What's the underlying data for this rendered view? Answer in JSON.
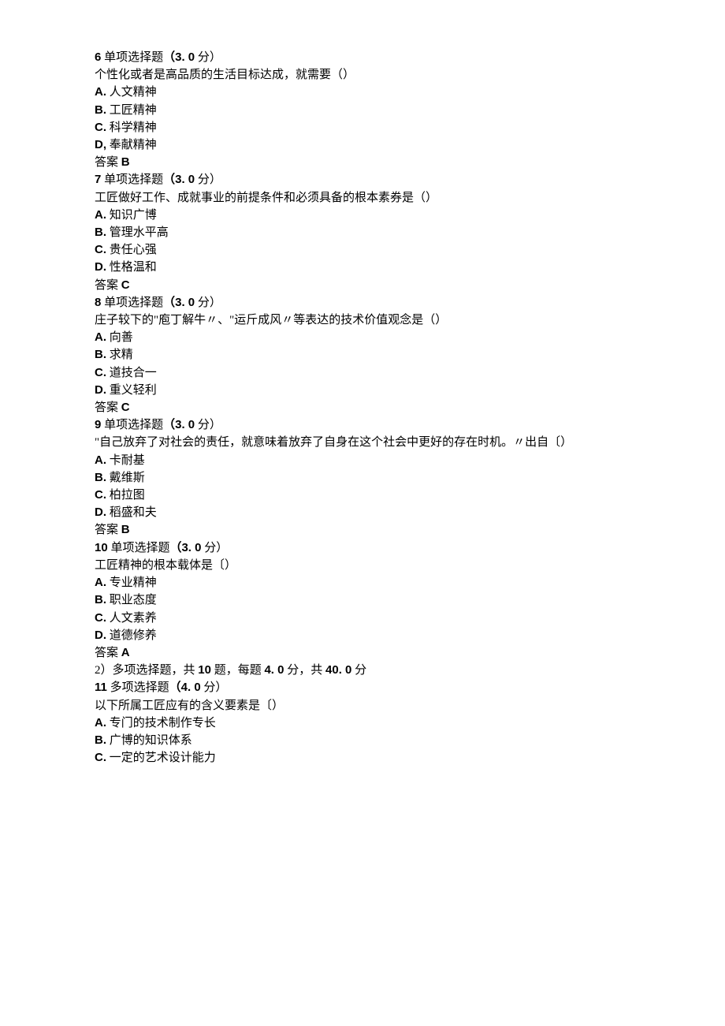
{
  "q6": {
    "header_num": "6",
    "header_type": " 单项选择题",
    "header_score_open": "（",
    "header_score": "3. 0",
    "header_score_close": " 分）",
    "stem": "个性化或者是高品质的生活目标达成，就需要（）",
    "optA_label": "A.",
    "optA_text": " 人文精神",
    "optB_label": "B.",
    "optB_text": " 工匠精神",
    "optC_label": "C.",
    "optC_text": " 科学精神",
    "optD_label": "D,",
    "optD_text": " 奉献精神",
    "answer_label": "答案 ",
    "answer_value": "B"
  },
  "q7": {
    "header_num": "7",
    "header_type": " 单项选择题",
    "header_score_open": "（",
    "header_score": "3. 0",
    "header_score_close": " 分）",
    "stem": "工匠做好工作、成就事业的前提条件和必须具备的根本素券是（）",
    "optA_label": "A.",
    "optA_text": " 知识广博",
    "optB_label": "B.",
    "optB_text": " 管理水平高",
    "optC_label": "C.",
    "optC_text": " 贵任心强",
    "optD_label": "D.",
    "optD_text": " 性格温和",
    "answer_label": "答案 ",
    "answer_value": "C"
  },
  "q8": {
    "header_num": "8",
    "header_type": " 单项选择题",
    "header_score_open": "（",
    "header_score": "3. 0",
    "header_score_close": " 分）",
    "stem": "庄子较下的\"庖丁解牛〃、\"运斤成风〃等表达的技术价值观念是（）",
    "optA_label": "A.",
    "optA_text": " 向善",
    "optB_label": "B.",
    "optB_text": " 求精",
    "optC_label": "C.",
    "optC_text": " 道技合一",
    "optD_label": "D.",
    "optD_text": " 重义轻利",
    "answer_label": "答案 ",
    "answer_value": "C"
  },
  "q9": {
    "header_num": "9",
    "header_type": " 单项选择题",
    "header_score_open": "（",
    "header_score": "3. 0",
    "header_score_close": " 分）",
    "stem": "\"自己放弃了对社会的责任，就意味着放弃了自身在这个社会中更好的存在时机。〃出自〔）",
    "optA_label": "A.",
    "optA_text": " 卡耐基",
    "optB_label": "B.",
    "optB_text": " 戴维斯",
    "optC_label": "C.",
    "optC_text": " 柏拉图",
    "optD_label": "D.",
    "optD_text": " 稻盛和夫",
    "answer_label": "答案 ",
    "answer_value": "B"
  },
  "q10": {
    "header_num": "10",
    "header_type": " 单项选择题",
    "header_score_open": "（",
    "header_score": "3. 0",
    "header_score_close": " 分）",
    "stem": "工匠精神的根本载体是〔）",
    "optA_label": "A.",
    "optA_text": " 专业精神",
    "optB_label": "B.",
    "optB_text": " 职业态度",
    "optC_label": "C.",
    "optC_text": " 人文素养",
    "optD_label": "D.",
    "optD_text": " 道德修养",
    "answer_label": "答案 ",
    "answer_value": "A"
  },
  "section2": {
    "p1": "2）多项选择题，共 ",
    "n1": "10",
    "p2": " 题，每题 ",
    "n2": "4. 0",
    "p3": " 分，共 ",
    "n3": "40. 0",
    "p4": " 分"
  },
  "q11": {
    "header_num": "11",
    "header_type": " 多项选择题",
    "header_score_open": "（",
    "header_score": "4. 0",
    "header_score_close": " 分）",
    "stem": "以下所属工匠应有的含义要素是〔）",
    "optA_label": "A.",
    "optA_text": " 专门的技术制作专长",
    "optB_label": "B.",
    "optB_text": " 广博的知识体系",
    "optC_label": "C.",
    "optC_text": " 一定的艺术设计能力"
  }
}
